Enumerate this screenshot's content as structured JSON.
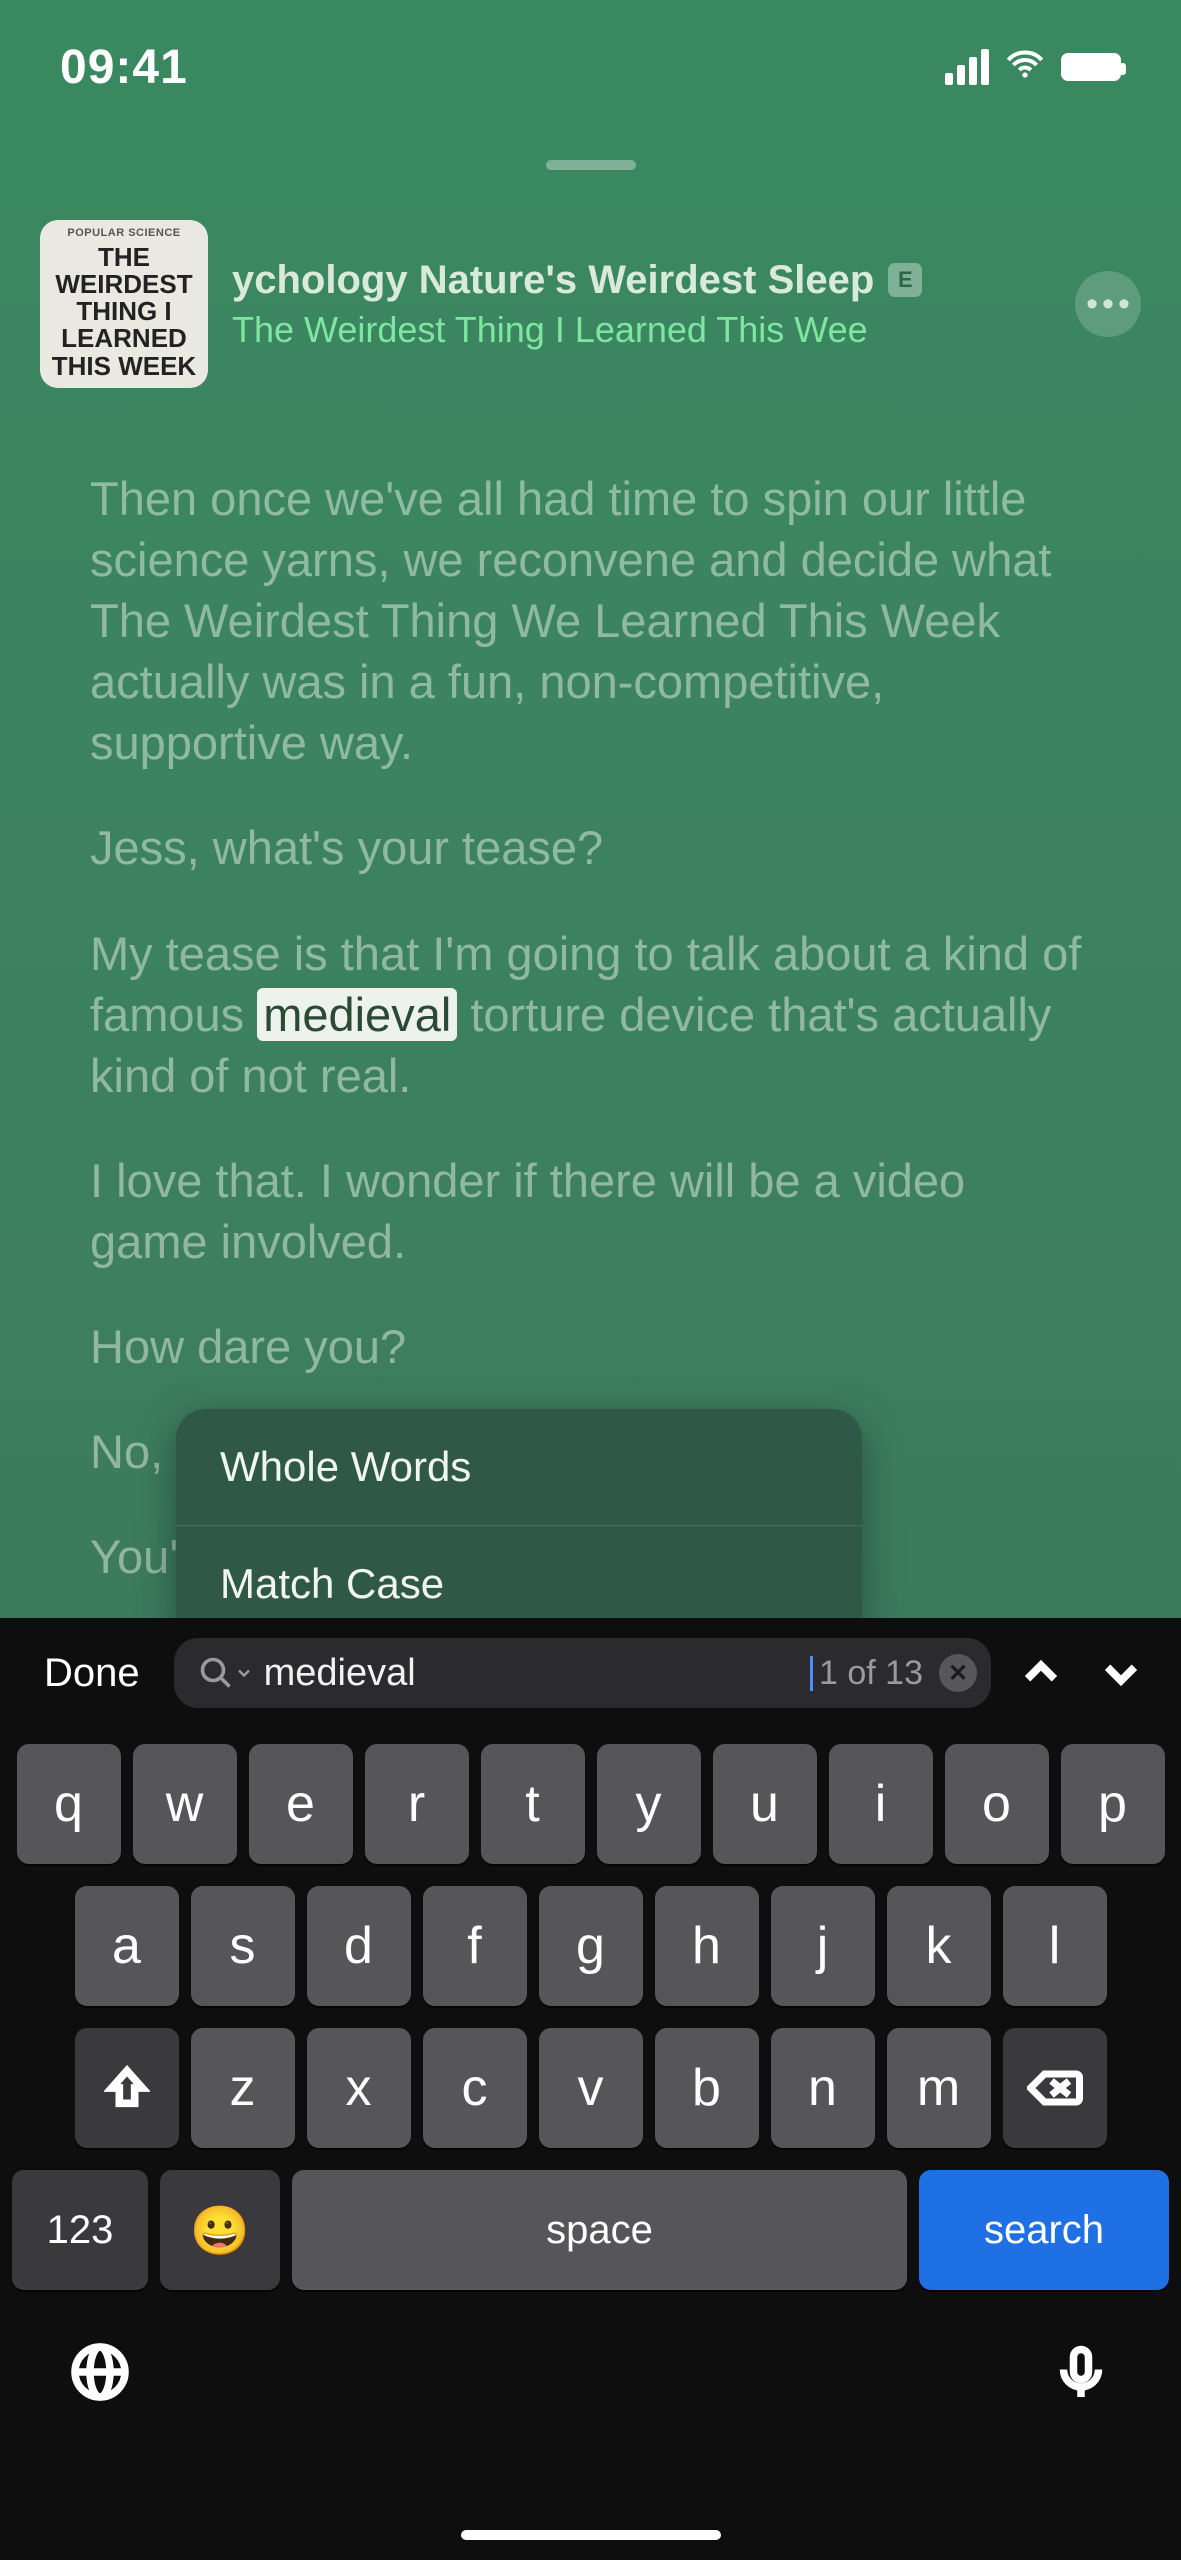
{
  "status": {
    "time": "09:41"
  },
  "artwork": {
    "topline": "POPULAR SCIENCE",
    "l1": "THE",
    "l2": "WEIRDEST",
    "l3": "THING I",
    "l4": "LEARNED",
    "l5": "THIS WEEK"
  },
  "header": {
    "title": "ychology     Nature's Weirdest Sleep",
    "explicit": "E",
    "subtitle": "The Weirdest Thing I Learned This Wee"
  },
  "transcript": {
    "p1": "Then once we've all had time to spin our little science yarns, we reconvene and decide what The Weirdest Thing We Learned This Week actually was in a fun, non-competitive, supportive way.",
    "p2": "Jess, what's your tease?",
    "p3_pre": "My tease is that I'm going to talk about a kind of famous ",
    "p3_hl": "medieval",
    "p3_post": " torture device that's actually kind of not real.",
    "p4": "I love that. I wonder if there will be a video game involved.",
    "p5": "How dare you?",
    "p6": "No, ",
    "p7": "You'"
  },
  "options": {
    "whole_words": "Whole Words",
    "match_case": "Match Case"
  },
  "search": {
    "done": "Done",
    "query": "medieval",
    "result_count": "1 of 13"
  },
  "keyboard": {
    "row1": [
      "q",
      "w",
      "e",
      "r",
      "t",
      "y",
      "u",
      "i",
      "o",
      "p"
    ],
    "row2": [
      "a",
      "s",
      "d",
      "f",
      "g",
      "h",
      "j",
      "k",
      "l"
    ],
    "row3": [
      "z",
      "x",
      "c",
      "v",
      "b",
      "n",
      "m"
    ],
    "numkey": "123",
    "space": "space",
    "search": "search"
  }
}
